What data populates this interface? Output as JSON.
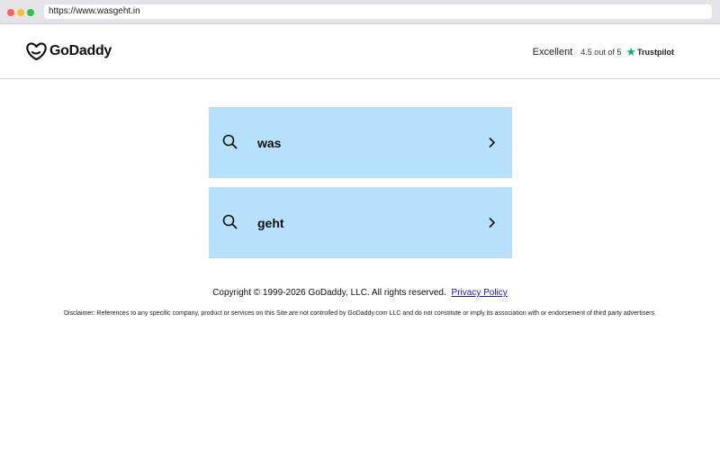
{
  "browser": {
    "url": "https://www.wasgeht.in"
  },
  "header": {
    "logo_text": "GoDaddy",
    "trustpilot": {
      "excellent": "Excellent",
      "rating": "4.5 out of 5",
      "name": "Trustpilot",
      "star_color": "#00b67a"
    }
  },
  "results": [
    {
      "term": "was",
      "icon": "search-icon",
      "action_icon": "chevron-right-icon"
    },
    {
      "term": "geht",
      "icon": "search-icon",
      "action_icon": "chevron-right-icon"
    }
  ],
  "footer": {
    "copyright": "Copyright © 1999-2026 GoDaddy, LLC. All rights reserved.",
    "privacy": "Privacy Policy",
    "disclaimer": "Disclaimer: References to any specific company, product or services on this Site are not controlled by GoDaddy.com LLC and do not constitute or imply its association with or endorsement of third party advertisers."
  },
  "colors": {
    "card_bg": "#b6e0fb",
    "link": "#1b1bb0"
  }
}
